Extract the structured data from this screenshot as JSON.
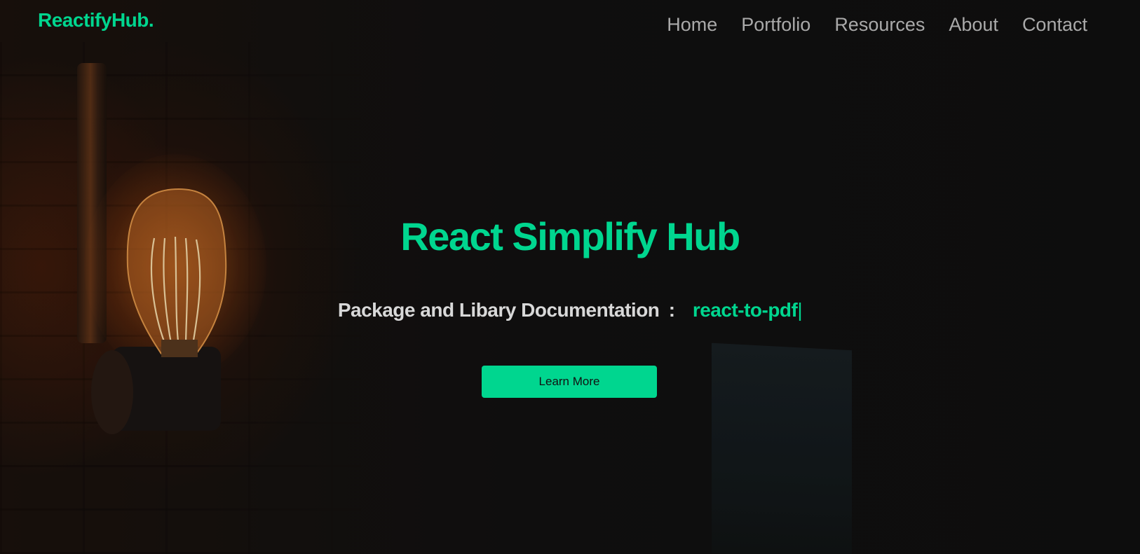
{
  "brand": {
    "logo_text": "ReactifyHub."
  },
  "nav": {
    "items": [
      {
        "label": "Home"
      },
      {
        "label": "Portfolio"
      },
      {
        "label": "Resources"
      },
      {
        "label": "About"
      },
      {
        "label": "Contact"
      }
    ]
  },
  "hero": {
    "title": "React Simplify Hub",
    "subtitle_label": "Package and Libary Documentation",
    "subtitle_separator": ":",
    "typed_text": "react-to-pdf",
    "cursor": "|",
    "cta_label": "Learn More",
    "background_image": "light-bulb-icon"
  },
  "colors": {
    "accent": "#00d68f",
    "nav_text": "#a9a9a9",
    "subtitle_text": "#d8d8d8",
    "background": "#121212"
  }
}
